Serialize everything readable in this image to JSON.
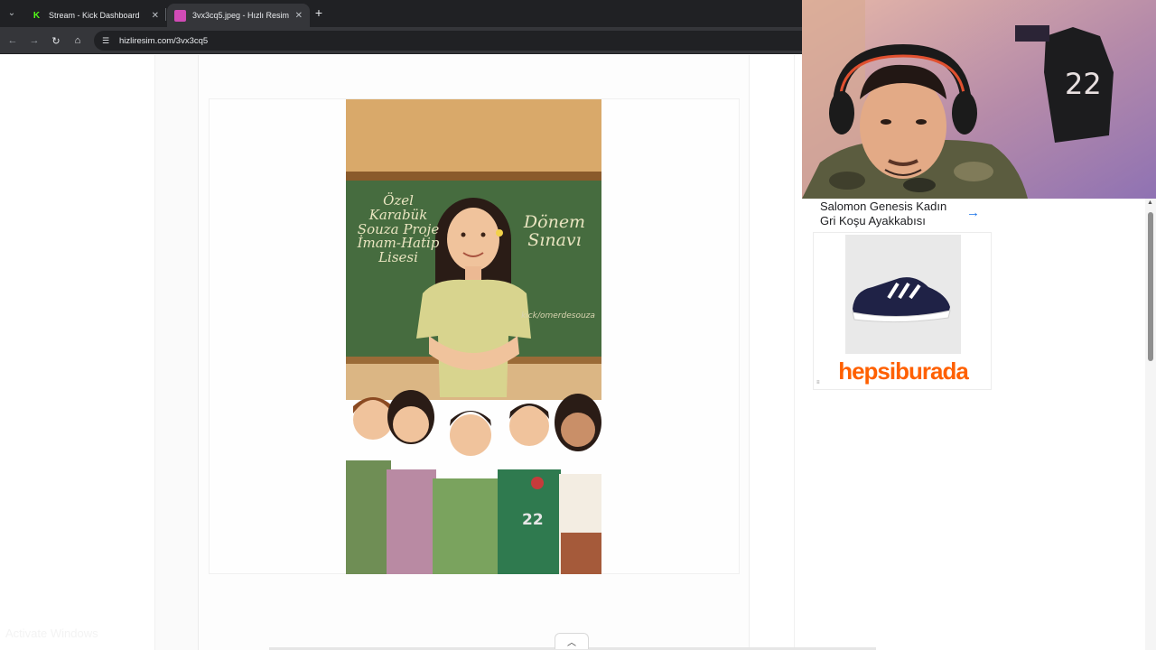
{
  "browser": {
    "tabs": [
      {
        "title": "Stream - Kick Dashboard",
        "favicon": "K",
        "favicon_color": "#53fc18",
        "active": false
      },
      {
        "title": "3vx3cq5.jpeg - Hızlı Resim",
        "favicon": "",
        "favicon_color": "#d14bb6",
        "active": true
      }
    ],
    "url": "hizliresim.com/3vx3cq5"
  },
  "poster": {
    "left_lines": [
      "Özel",
      "Karabük",
      "Souza Proje",
      "İmam-Hatip",
      "Lisesi"
    ],
    "right_lines": [
      "Dönem",
      "Sınavı"
    ],
    "handle": "kick/omerdesouza",
    "jersey_number": "22"
  },
  "ad": {
    "title": "Salomon Genesis Kadın Gri Koşu Ayakkabısı",
    "brand": "hepsiburada",
    "brand_color": "#ff6000"
  },
  "watermark": "Activate Windows"
}
